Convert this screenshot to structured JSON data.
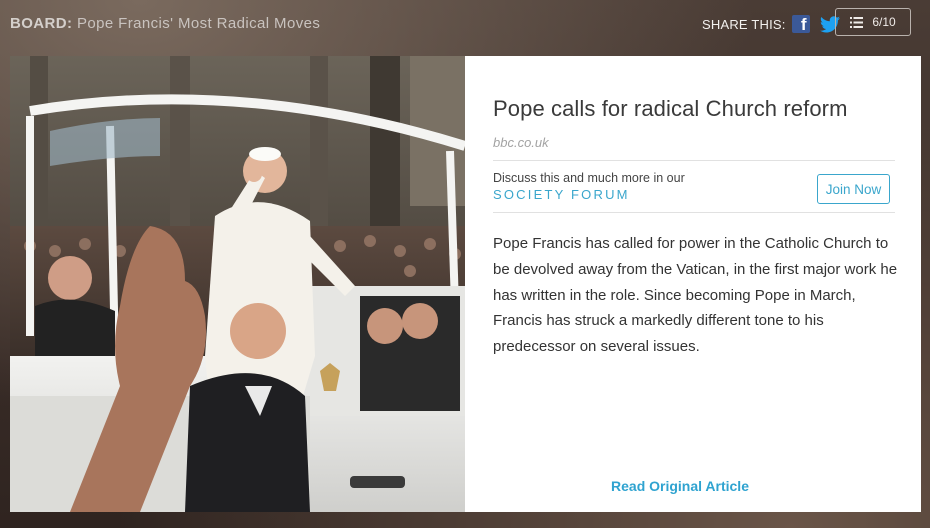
{
  "header": {
    "board_prefix": "BOARD:",
    "board_title": "Pope Francis' Most Radical Moves",
    "share_label": "SHARE THIS:",
    "counter": "6/10"
  },
  "icons": {
    "facebook": "facebook-icon",
    "twitter": "twitter-icon",
    "list": "list-icon"
  },
  "colors": {
    "accent": "#3aa6cc",
    "facebook": "#3b5998",
    "twitter": "#1da1f2"
  },
  "article": {
    "headline": "Pope calls for radical Church reform",
    "source": "bbc.co.uk",
    "forum_text": "Discuss this and much more in our",
    "forum_link": "SOCIETY FORUM",
    "join_label": "Join Now",
    "body": "Pope Francis has called for power in the Catholic Church to be devolved away from the Vatican, in the first major work he has written in the role. Since becoming Pope in March, Francis has struck a markedly different tone to his predecessor on several issues.",
    "read_link": "Read Original Article"
  }
}
